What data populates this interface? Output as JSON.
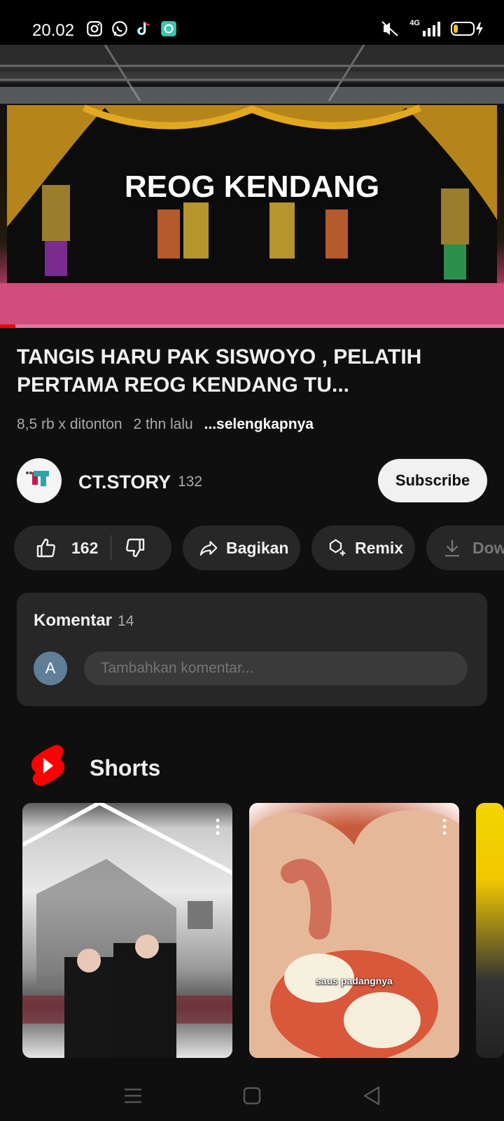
{
  "status_bar": {
    "time": "20.02",
    "network": "4G"
  },
  "video": {
    "overlay_text": "REOG KENDANG",
    "progress": 0.03
  },
  "details": {
    "title": "TANGIS HARU PAK SISWOYO , PELATIH PERTAMA REOG KENDANG TU...",
    "views": "8,5 rb x ditonton",
    "age": "2 thn lalu",
    "more": "...selengkapnya"
  },
  "channel": {
    "name": "CT.STORY",
    "subscribers": "132",
    "subscribe_label": "Subscribe"
  },
  "actions": {
    "likes": "162",
    "share": "Bagikan",
    "remix": "Remix",
    "download": "Download"
  },
  "comments": {
    "title": "Komentar",
    "count": "14",
    "avatar_letter": "A",
    "placeholder": "Tambahkan komentar..."
  },
  "shorts": {
    "title": "Shorts",
    "items": [
      {
        "caption": ""
      },
      {
        "caption": "saus padangnya"
      },
      {
        "caption": ""
      }
    ]
  },
  "colors": {
    "background": "#0f0f0f",
    "pill": "#272727",
    "shorts_red": "#ff0000"
  }
}
